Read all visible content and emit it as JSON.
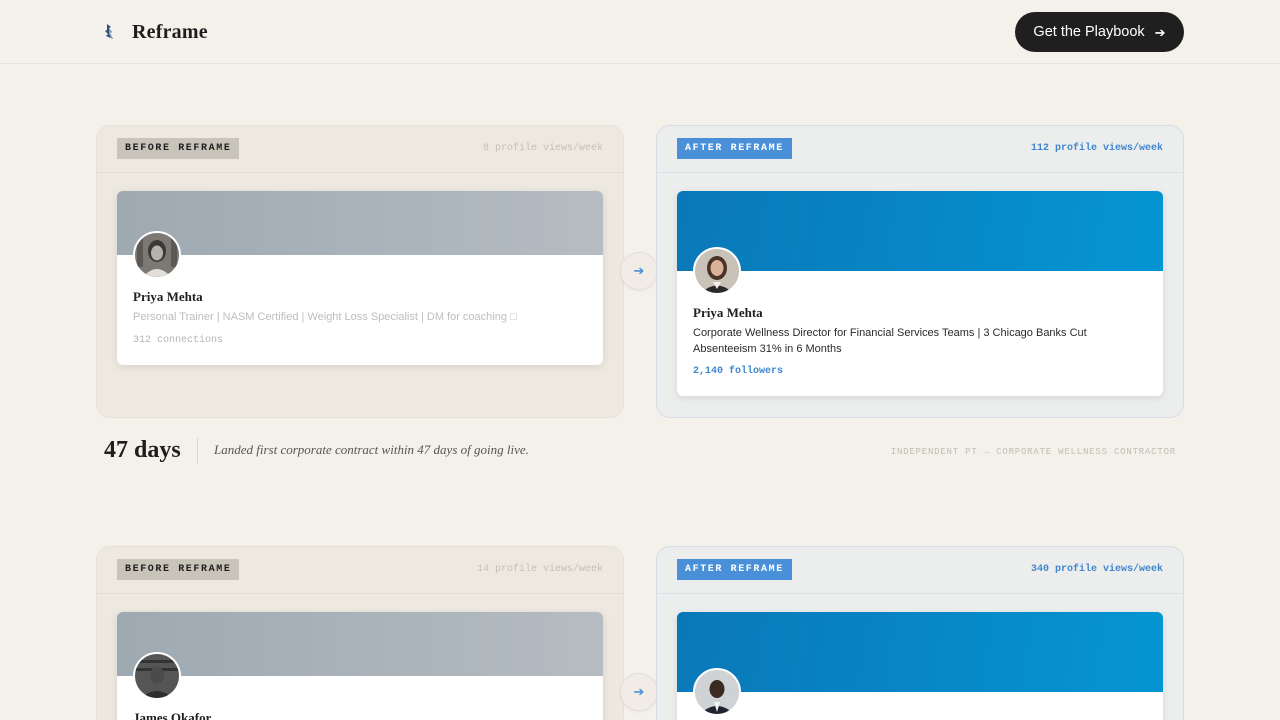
{
  "header": {
    "brand_name": "Reframe",
    "cta_label": "Get the Playbook",
    "cta_icon": "arrow-right-icon"
  },
  "cases": [
    {
      "before": {
        "tag": "BEFORE REFRAME",
        "views": "8 profile views/week",
        "name": "Priya Mehta",
        "headline": "Personal Trainer | NASM Certified | Weight Loss Specialist | DM for coaching □",
        "stat": "312 connections"
      },
      "after": {
        "tag": "AFTER REFRAME",
        "views": "112 profile views/week",
        "name": "Priya Mehta",
        "headline": "Corporate Wellness Director for Financial Services Teams | 3 Chicago Banks Cut Absenteeism 31% in 6 Months",
        "stat": "2,140 followers"
      },
      "result": {
        "days": "47 days",
        "text": "Landed first corporate contract within 47 days of going live.",
        "meta": "INDEPENDENT PT → CORPORATE WELLNESS CONTRACTOR"
      }
    },
    {
      "before": {
        "tag": "BEFORE REFRAME",
        "views": "14 profile views/week",
        "name": "James Okafor"
      },
      "after": {
        "tag": "AFTER REFRAME",
        "views": "340 profile views/week"
      }
    }
  ],
  "colors": {
    "page_bg": "#f4f1ea",
    "accent_blue": "#4a90d9",
    "linkedin_blue": "#0a78b8",
    "cta_bg": "#1f1f1f"
  }
}
